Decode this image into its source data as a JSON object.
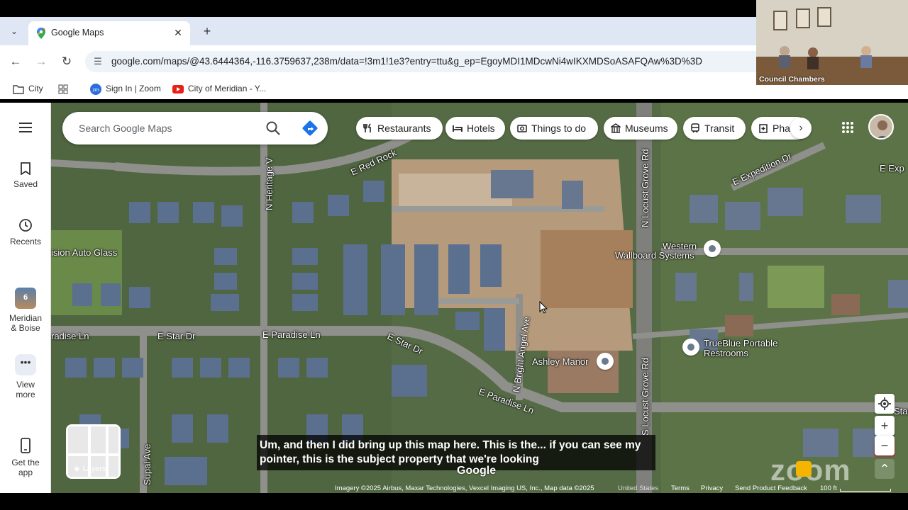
{
  "browser": {
    "tab_title": "Google Maps",
    "url": "google.com/maps/@43.6444364,-116.3759637,238m/data=!3m1!1e3?entry=ttu&g_ep=EgoyMDI1MDcwNi4wIKXMDSoASAFQAw%3D%3D",
    "bookmarks": [
      {
        "label": "City"
      },
      {
        "label": "Sign In | Zoom"
      },
      {
        "label": "City of Meridian - Y..."
      }
    ]
  },
  "rail": {
    "saved": "Saved",
    "recents": "Recents",
    "recent_place": "Meridian & Boise",
    "recent_place_line1": "Meridian",
    "recent_place_line2": "& Boise",
    "recent_badge": "6",
    "view_more_line1": "View",
    "view_more_line2": "more",
    "get_app_line1": "Get the",
    "get_app_line2": "app"
  },
  "search": {
    "placeholder": "Search Google Maps"
  },
  "chips": [
    {
      "label": "Restaurants",
      "icon": "fork-knife-icon"
    },
    {
      "label": "Hotels",
      "icon": "bed-icon"
    },
    {
      "label": "Things to do",
      "icon": "camera-icon"
    },
    {
      "label": "Museums",
      "icon": "museum-icon"
    },
    {
      "label": "Transit",
      "icon": "train-icon"
    },
    {
      "label": "Pharmacies",
      "icon": "pharmacy-icon"
    }
  ],
  "map_labels": {
    "e_red_rock": "E Red Rock",
    "n_heritage": "N Heritage V",
    "vision_auto": "ision Auto Glass",
    "paradise_ln_left": "radise Ln",
    "e_star_dr_left": "E Star Dr",
    "e_paradise_ln": "E Paradise Ln",
    "e_star_dr": "E Star Dr",
    "n_bright_angel": "N Bright Angel Ave",
    "e_paradise_ln_lower": "E Paradise Ln",
    "supal_ave": "Supal Ave",
    "n_locust_grove": "N Locust Grove Rd",
    "s_locust_grove": "S Locust Grove Rd",
    "e_expedition": "E Expedition Dr",
    "e_exp": "E Exp",
    "western_1": "Western",
    "western_2": "Wallboard Systems",
    "trueblue_1": "TrueBlue Portable",
    "trueblue_2": "Restrooms",
    "ashley_manor": "Ashley Manor",
    "star_right": "Star"
  },
  "layers_label": "Layers",
  "caption": "Um, and then I did bring up this map here. This is the... if you can see my pointer, this is the subject property that we're looking",
  "google_logo": "Google",
  "attribution": {
    "imagery": "Imagery ©2025 Airbus, Maxar Technologies, Vexcel Imaging US, Inc., Map data ©2025",
    "country": "United States",
    "terms": "Terms",
    "privacy": "Privacy",
    "feedback": "Send Product Feedback",
    "scale": "100 ft"
  },
  "video": {
    "label": "Council Chambers"
  },
  "zoom_watermark": "zoom"
}
